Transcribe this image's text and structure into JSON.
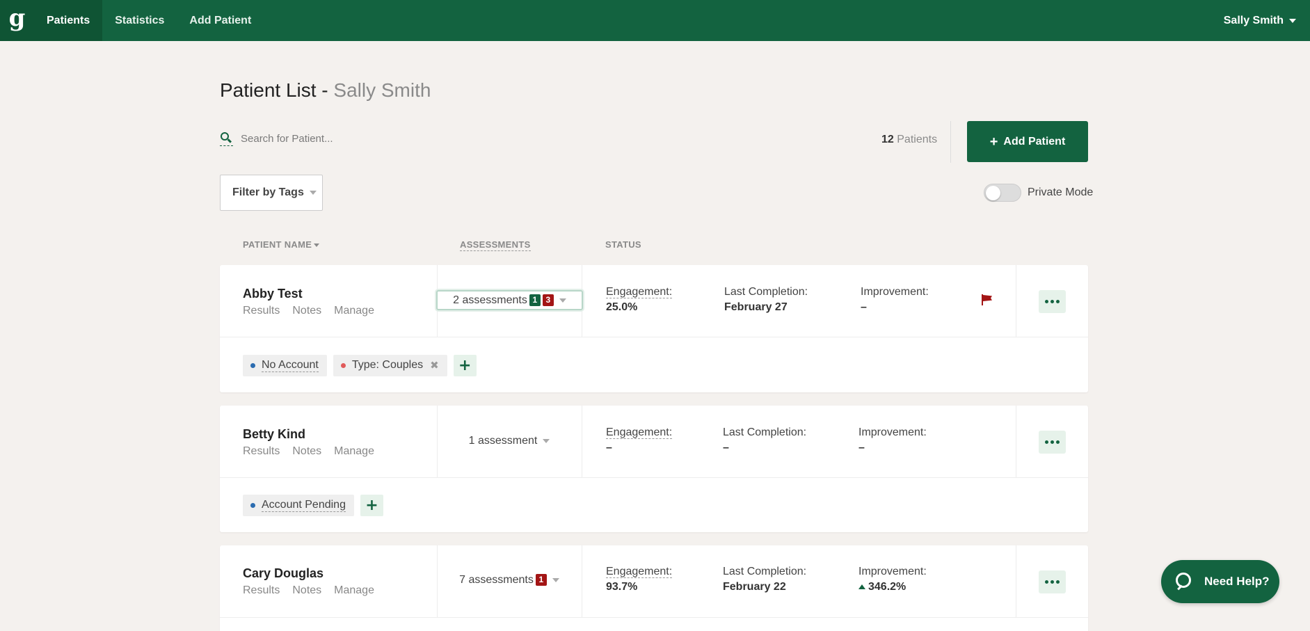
{
  "nav": {
    "logo": "g",
    "tabs": [
      {
        "label": "Patients",
        "active": true
      },
      {
        "label": "Statistics",
        "active": false
      },
      {
        "label": "Add Patient",
        "active": false
      }
    ],
    "user": "Sally Smith"
  },
  "header": {
    "title": "Patient List - ",
    "subtitle": "Sally Smith"
  },
  "search": {
    "placeholder": "Search for Patient..."
  },
  "count": {
    "number": "12",
    "label": "Patients"
  },
  "add_patient_button": {
    "label": "Add Patient"
  },
  "filter": {
    "label": "Filter by Tags"
  },
  "private_mode": {
    "label": "Private Mode",
    "enabled": false
  },
  "columns": {
    "name": "PATIENT NAME",
    "assessments": "ASSESSMENTS",
    "status": "STATUS"
  },
  "row_links": [
    "Results",
    "Notes",
    "Manage"
  ],
  "status_labels": {
    "engagement": "Engagement:",
    "last_completion": "Last Completion:",
    "improvement": "Improvement:"
  },
  "patients": [
    {
      "name": "Abby Test",
      "assessments": "2 assessments",
      "badge_green": "1",
      "badge_red": "3",
      "engagement": "25.0%",
      "last_completion": "February 27",
      "improvement": "–",
      "flagged": true,
      "tags": [
        {
          "label": "No Account",
          "color": "#2b6cb0",
          "removable": false
        },
        {
          "label": "Type: Couples",
          "color": "#e05a5a",
          "removable": true
        }
      ]
    },
    {
      "name": "Betty Kind",
      "assessments": "1 assessment",
      "engagement": "–",
      "last_completion": "–",
      "improvement": "–",
      "flagged": false,
      "tags": [
        {
          "label": "Account Pending",
          "color": "#2b6cb0",
          "removable": false
        }
      ]
    },
    {
      "name": "Cary Douglas",
      "assessments": "7 assessments",
      "badge_red": "1",
      "engagement": "93.7%",
      "last_completion": "February 22",
      "improvement": "346.2%",
      "flagged": false
    }
  ],
  "help_button": {
    "label": "Need Help?"
  },
  "colors": {
    "brand": "#136340",
    "alert": "#a31515",
    "background": "#f4f1ee"
  }
}
